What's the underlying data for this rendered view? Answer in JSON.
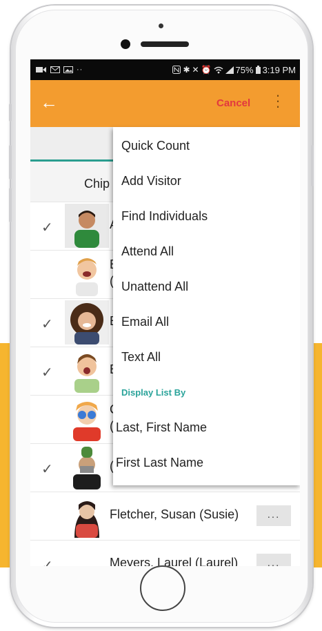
{
  "status_bar": {
    "left_icons": [
      "video-icon",
      "mail-icon",
      "image-icon",
      "more-icon"
    ],
    "right_icons": [
      "nfc-icon",
      "bluetooth-icon",
      "mute-icon",
      "alarm-icon",
      "wifi-icon",
      "signal-icon"
    ],
    "battery": "75%",
    "time": "3:19 PM"
  },
  "toolbar": {
    "back_icon": "arrow-left-icon",
    "cancel_label": "Cancel",
    "menu_icon": "vertical-dots-icon",
    "accent": "#f39c2f",
    "cancel_color": "#e2383f"
  },
  "list": {
    "group_label": "Chip",
    "rows": [
      {
        "checked": true,
        "name": "A",
        "photo": "boy-green-shirt"
      },
      {
        "checked": false,
        "name": "E",
        "name2": "(",
        "photo": "boy-laughing"
      },
      {
        "checked": true,
        "name": "E",
        "photo": "woman-curly-hair"
      },
      {
        "checked": true,
        "name": "E",
        "photo": "boy-surprised"
      },
      {
        "checked": false,
        "name": "C",
        "name2": "(",
        "photo": "girl-blue-glasses"
      },
      {
        "checked": true,
        "name": "(",
        "photo": "man-cactus-hat"
      },
      {
        "checked": false,
        "name": "Fletcher, Susan (Susie)",
        "more_label": "...",
        "photo": "woman-red-scarf"
      },
      {
        "checked": true,
        "name": "Meyers, Laurel (Laurel)",
        "more_label": "..."
      }
    ]
  },
  "menu": {
    "items": [
      "Quick Count",
      "Add Visitor",
      "Find Individuals",
      "Attend All",
      "Unattend All",
      "Email All",
      "Text All"
    ],
    "section_title": "Display List By",
    "sort_options": [
      "Last, First Name",
      "First Last Name"
    ],
    "section_color": "#2aa39a"
  }
}
